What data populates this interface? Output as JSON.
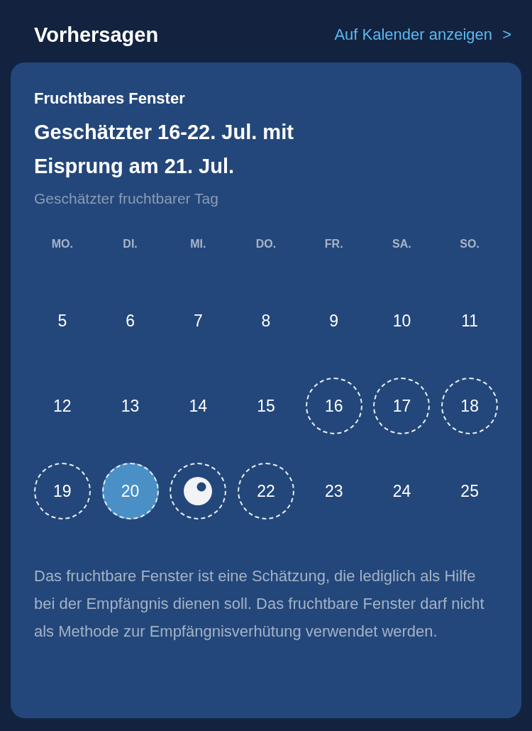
{
  "header": {
    "title": "Vorhersagen",
    "link": "Auf Kalender anzeigen",
    "link_icon": ">"
  },
  "card": {
    "title": "Fruchtbares Fenster",
    "headline": "Geschätzter 16-22. Jul. mit Eisprung am 21. Jul.",
    "subtitle": "Geschätzter fruchtbarer Tag",
    "weekdays": [
      "MO.",
      "DI.",
      "MI.",
      "DO.",
      "FR.",
      "SA.",
      "SO."
    ],
    "weeks": [
      [
        {
          "kind": "day",
          "label": "5",
          "fertile": false,
          "selected": false
        },
        {
          "kind": "day",
          "label": "6",
          "fertile": false,
          "selected": false
        },
        {
          "kind": "day",
          "label": "7",
          "fertile": false,
          "selected": false
        },
        {
          "kind": "day",
          "label": "8",
          "fertile": false,
          "selected": false
        },
        {
          "kind": "day",
          "label": "9",
          "fertile": false,
          "selected": false
        },
        {
          "kind": "day",
          "label": "10",
          "fertile": false,
          "selected": false
        },
        {
          "kind": "day",
          "label": "11",
          "fertile": false,
          "selected": false
        }
      ],
      [
        {
          "kind": "day",
          "label": "12",
          "fertile": false,
          "selected": false
        },
        {
          "kind": "day",
          "label": "13",
          "fertile": false,
          "selected": false
        },
        {
          "kind": "day",
          "label": "14",
          "fertile": false,
          "selected": false
        },
        {
          "kind": "day",
          "label": "15",
          "fertile": false,
          "selected": false
        },
        {
          "kind": "day",
          "label": "16",
          "fertile": true,
          "selected": false
        },
        {
          "kind": "day",
          "label": "17",
          "fertile": true,
          "selected": false
        },
        {
          "kind": "day",
          "label": "18",
          "fertile": true,
          "selected": false
        }
      ],
      [
        {
          "kind": "day",
          "label": "19",
          "fertile": true,
          "selected": false
        },
        {
          "kind": "day",
          "label": "20",
          "fertile": true,
          "selected": true
        },
        {
          "kind": "ovulation",
          "fertile": true,
          "selected": false
        },
        {
          "kind": "day",
          "label": "22",
          "fertile": true,
          "selected": false
        },
        {
          "kind": "day",
          "label": "23",
          "fertile": false,
          "selected": false
        },
        {
          "kind": "day",
          "label": "24",
          "fertile": false,
          "selected": false
        },
        {
          "kind": "day",
          "label": "25",
          "fertile": false,
          "selected": false
        }
      ]
    ],
    "disclaimer": "Das fruchtbare Fenster ist eine Schätzung, die lediglich als Hilfe bei der Empfängnis dienen soll. Das fruchtbare Fenster darf nicht als Methode zur Empfängnisverhütung verwendet werden."
  }
}
